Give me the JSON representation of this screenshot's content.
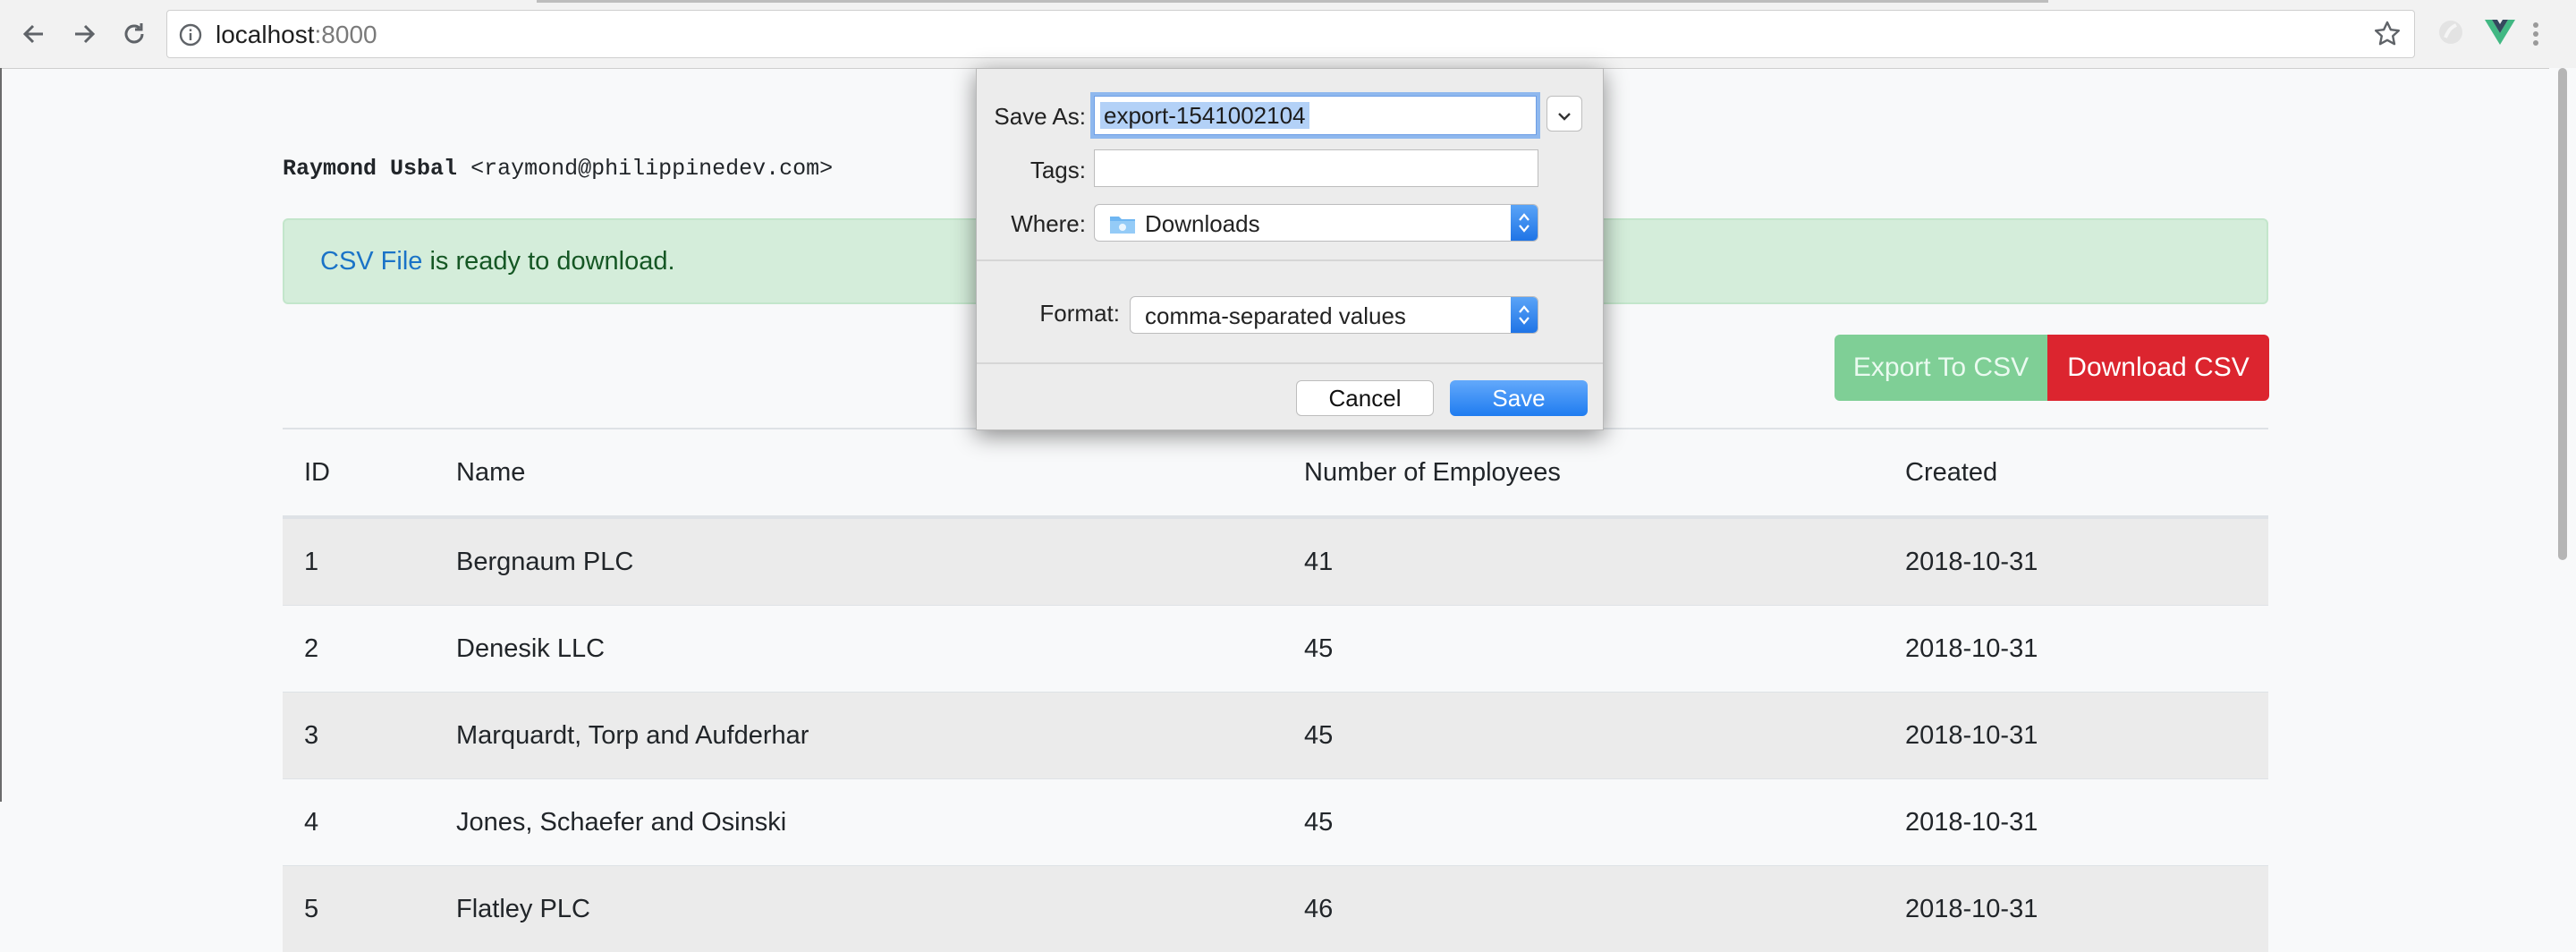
{
  "browser": {
    "url_host": "localhost",
    "url_port": ":8000"
  },
  "user_line": {
    "name": "Raymond Usbal",
    "email": "<raymond@philippinedev.com>"
  },
  "alert": {
    "link_text": "CSV File",
    "message": " is ready to download."
  },
  "actions": {
    "export_label": "Export To CSV",
    "download_label": "Download CSV"
  },
  "table": {
    "headers": [
      "ID",
      "Name",
      "Number of Employees",
      "Created"
    ],
    "rows": [
      [
        "1",
        "Bergnaum PLC",
        "41",
        "2018-10-31"
      ],
      [
        "2",
        "Denesik LLC",
        "45",
        "2018-10-31"
      ],
      [
        "3",
        "Marquardt, Torp and Aufderhar",
        "45",
        "2018-10-31"
      ],
      [
        "4",
        "Jones, Schaefer and Osinski",
        "45",
        "2018-10-31"
      ],
      [
        "5",
        "Flatley PLC",
        "46",
        "2018-10-31"
      ]
    ]
  },
  "dialog": {
    "save_as_label": "Save As:",
    "save_as_value": "export-1541002104",
    "tags_label": "Tags:",
    "tags_value": "",
    "where_label": "Where:",
    "where_value": "Downloads",
    "format_label": "Format:",
    "format_value": "comma-separated values",
    "cancel_label": "Cancel",
    "save_label": "Save"
  },
  "colors": {
    "alert_bg": "#d4edda",
    "alert_text": "#155724",
    "export_btn": "#7fcf96",
    "download_btn": "#dc252f",
    "dialog_accent": "#1f7cf0"
  },
  "icons": [
    "back-arrow-icon",
    "forward-arrow-icon",
    "reload-icon",
    "info-icon",
    "star-icon",
    "vue-extension-icon",
    "folder-icon",
    "chevron-down-icon",
    "updown-arrows-icon"
  ]
}
